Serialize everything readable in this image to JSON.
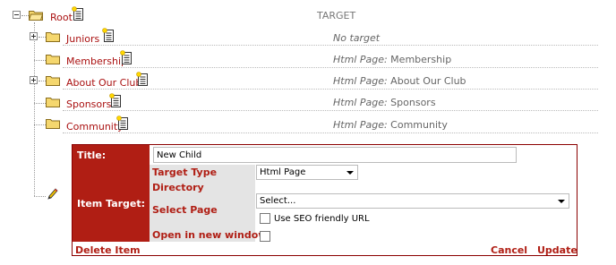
{
  "tree": {
    "column_header": "TARGET",
    "root": {
      "label": "Root"
    },
    "nodes": [
      {
        "label": "Juniors",
        "target_prefix": "",
        "target_value": "No target",
        "expandable": true
      },
      {
        "label": "Membership",
        "target_prefix": "Html Page:",
        "target_value": " Membership",
        "expandable": false
      },
      {
        "label": "About Our Club",
        "target_prefix": "Html Page:",
        "target_value": " About Our Club",
        "expandable": true
      },
      {
        "label": "Sponsors",
        "target_prefix": "Html Page:",
        "target_value": " Sponsors",
        "expandable": false
      },
      {
        "label": "Community",
        "target_prefix": "Html Page:",
        "target_value": " Community",
        "expandable": false
      }
    ]
  },
  "editor": {
    "title_label": "Title:",
    "title_value": "New Child",
    "item_target_label": "Item Target:",
    "target_type_label": "Target Type",
    "target_type_value": "Html Page",
    "directory_label": "Directory",
    "select_page_label": "Select Page",
    "select_page_value": "Select...",
    "seo_label": "Use SEO friendly URL",
    "seo_checked": false,
    "new_window_label": "Open in new window",
    "new_window_checked": false,
    "delete_label": "Delete Item",
    "cancel_label": "Cancel",
    "update_label": "Update"
  },
  "colors": {
    "accent": "#b01e14",
    "link": "#aa1111",
    "folder": "#f5d76e"
  }
}
